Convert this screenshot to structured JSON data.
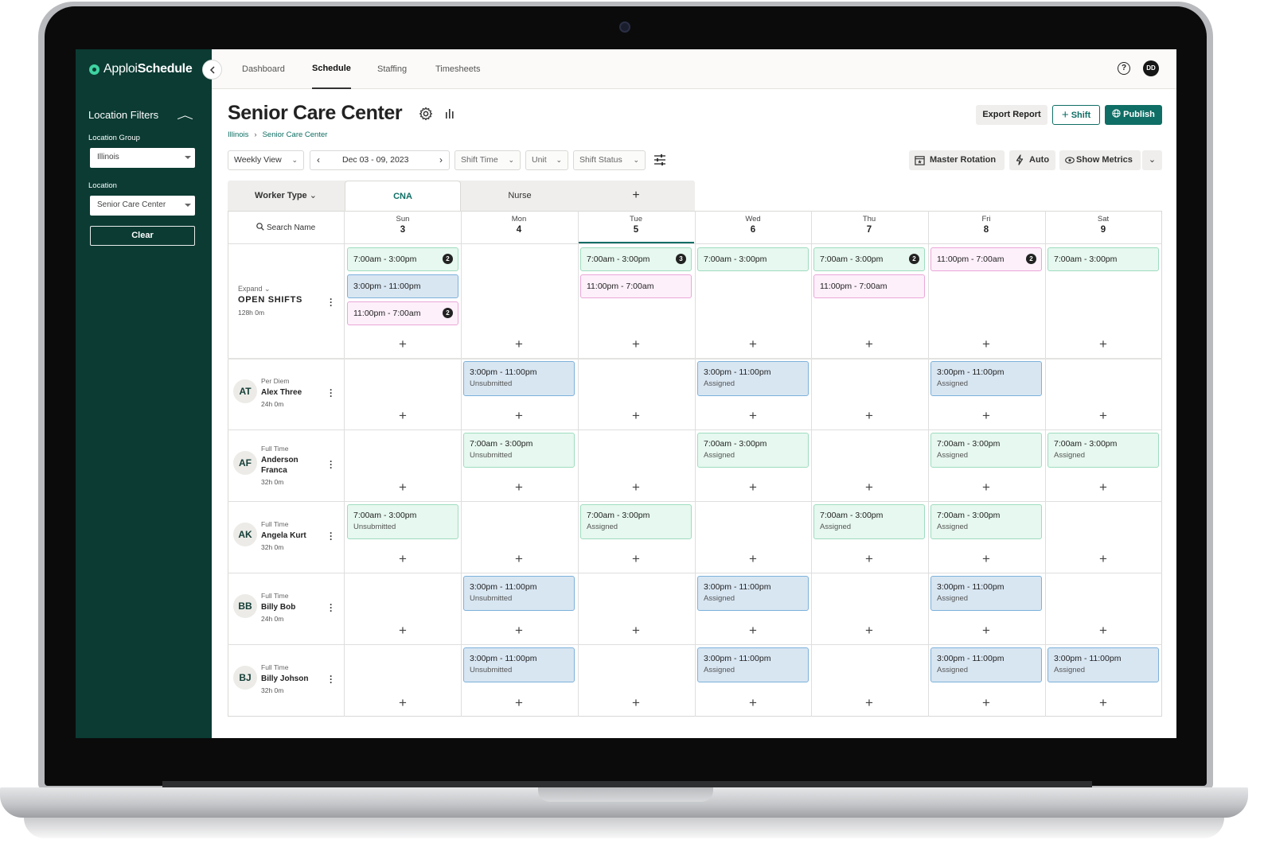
{
  "app": {
    "logo_light": "Apploi",
    "logo_bold": "Schedule",
    "user_initials": "DD",
    "help": "?"
  },
  "nav": [
    "Dashboard",
    "Schedule",
    "Staffing",
    "Timesheets"
  ],
  "sidebar": {
    "title": "Location Filters",
    "location_group_label": "Location Group",
    "location_group_value": "Illinois",
    "location_label": "Location",
    "location_value": "Senior Care Center",
    "clear_label": "Clear"
  },
  "header": {
    "title": "Senior Care Center",
    "breadcrumb": [
      "Illinois",
      "Senior Care Center"
    ],
    "export_label": "Export Report",
    "shift_label": "Shift",
    "publish_label": "Publish"
  },
  "toolbar": {
    "view": "Weekly View",
    "date_range": "Dec 03 - 09, 2023",
    "shift_time": "Shift Time",
    "unit": "Unit",
    "shift_status": "Shift Status",
    "master_rotation": "Master Rotation",
    "auto": "Auto",
    "show_metrics": "Show Metrics"
  },
  "tabs": {
    "worker_type": "Worker Type",
    "items": [
      "CNA",
      "Nurse"
    ],
    "active": "CNA"
  },
  "grid": {
    "search_label": "Search Name",
    "days": [
      {
        "name": "Sun",
        "num": "3"
      },
      {
        "name": "Mon",
        "num": "4"
      },
      {
        "name": "Tue",
        "num": "5"
      },
      {
        "name": "Wed",
        "num": "6"
      },
      {
        "name": "Thu",
        "num": "7"
      },
      {
        "name": "Fri",
        "num": "8"
      },
      {
        "name": "Sat",
        "num": "9"
      }
    ],
    "open_shifts": {
      "expand": "Expand",
      "title": "OPEN SHIFTS",
      "hours": "128h 0m"
    },
    "open": [
      {
        "day": 0,
        "slot": 0,
        "time": "7:00am - 3:00pm",
        "color": "green",
        "count": "2"
      },
      {
        "day": 0,
        "slot": 1,
        "time": "3:00pm - 11:00pm",
        "color": "blue"
      },
      {
        "day": 0,
        "slot": 2,
        "time": "11:00pm - 7:00am",
        "color": "pink",
        "count": "2"
      },
      {
        "day": 2,
        "slot": 0,
        "time": "7:00am - 3:00pm",
        "color": "green",
        "count": "3"
      },
      {
        "day": 2,
        "slot": 1,
        "time": "11:00pm - 7:00am",
        "color": "pink"
      },
      {
        "day": 3,
        "slot": 0,
        "time": "7:00am - 3:00pm",
        "color": "green"
      },
      {
        "day": 4,
        "slot": 0,
        "time": "7:00am - 3:00pm",
        "color": "green",
        "count": "2"
      },
      {
        "day": 4,
        "slot": 1,
        "time": "11:00pm - 7:00am",
        "color": "pink"
      },
      {
        "day": 5,
        "slot": 0,
        "time": "11:00pm - 7:00am",
        "color": "pink",
        "count": "2"
      },
      {
        "day": 6,
        "slot": 0,
        "time": "7:00am - 3:00pm",
        "color": "green"
      }
    ],
    "workers": [
      {
        "initials": "AT",
        "type": "Per Diem",
        "name": "Alex Three",
        "hours": "24h 0m",
        "shifts": [
          {
            "day": 1,
            "time": "3:00pm - 11:00pm",
            "status": "Unsubmitted",
            "color": "blue"
          },
          {
            "day": 3,
            "time": "3:00pm - 11:00pm",
            "status": "Assigned",
            "color": "blue"
          },
          {
            "day": 5,
            "time": "3:00pm - 11:00pm",
            "status": "Assigned",
            "color": "blue"
          }
        ]
      },
      {
        "initials": "AF",
        "type": "Full Time",
        "name": "Anderson Franca",
        "hours": "32h 0m",
        "shifts": [
          {
            "day": 1,
            "time": "7:00am - 3:00pm",
            "status": "Unsubmitted",
            "color": "green"
          },
          {
            "day": 3,
            "time": "7:00am - 3:00pm",
            "status": "Assigned",
            "color": "green"
          },
          {
            "day": 5,
            "time": "7:00am - 3:00pm",
            "status": "Assigned",
            "color": "green"
          },
          {
            "day": 6,
            "time": "7:00am - 3:00pm",
            "status": "Assigned",
            "color": "green"
          }
        ]
      },
      {
        "initials": "AK",
        "type": "Full Time",
        "name": "Angela Kurt",
        "hours": "32h 0m",
        "shifts": [
          {
            "day": 0,
            "time": "7:00am - 3:00pm",
            "status": "Unsubmitted",
            "color": "green"
          },
          {
            "day": 2,
            "time": "7:00am - 3:00pm",
            "status": "Assigned",
            "color": "green"
          },
          {
            "day": 4,
            "time": "7:00am - 3:00pm",
            "status": "Assigned",
            "color": "green"
          },
          {
            "day": 5,
            "time": "7:00am - 3:00pm",
            "status": "Assigned",
            "color": "green"
          }
        ]
      },
      {
        "initials": "BB",
        "type": "Full Time",
        "name": "Billy Bob",
        "hours": "24h 0m",
        "shifts": [
          {
            "day": 1,
            "time": "3:00pm - 11:00pm",
            "status": "Unsubmitted",
            "color": "blue"
          },
          {
            "day": 3,
            "time": "3:00pm - 11:00pm",
            "status": "Assigned",
            "color": "blue"
          },
          {
            "day": 5,
            "time": "3:00pm - 11:00pm",
            "status": "Assigned",
            "color": "blue"
          }
        ]
      },
      {
        "initials": "BJ",
        "type": "Full Time",
        "name": "Billy Johson",
        "hours": "32h 0m",
        "shifts": [
          {
            "day": 1,
            "time": "3:00pm - 11:00pm",
            "status": "Unsubmitted",
            "color": "blue"
          },
          {
            "day": 3,
            "time": "3:00pm - 11:00pm",
            "status": "Assigned",
            "color": "blue"
          },
          {
            "day": 5,
            "time": "3:00pm - 11:00pm",
            "status": "Assigned",
            "color": "blue"
          },
          {
            "day": 6,
            "time": "3:00pm - 11:00pm",
            "status": "Assigned",
            "color": "blue"
          }
        ]
      }
    ]
  },
  "colors": {
    "sidebar_bg": "#0b3b33",
    "accent": "#0f6e65",
    "shift_green": "#e6f8ef",
    "shift_blue": "#d8e6f2",
    "shift_pink": "#fdf0fa"
  },
  "icons": [
    "gear-icon",
    "bar-chart-icon",
    "plus-icon",
    "globe-icon",
    "calendar-star-icon",
    "lightning-icon",
    "eye-icon",
    "sliders-icon",
    "search-icon",
    "help-icon",
    "chevron-down-icon",
    "kebab-menu-icon"
  ]
}
